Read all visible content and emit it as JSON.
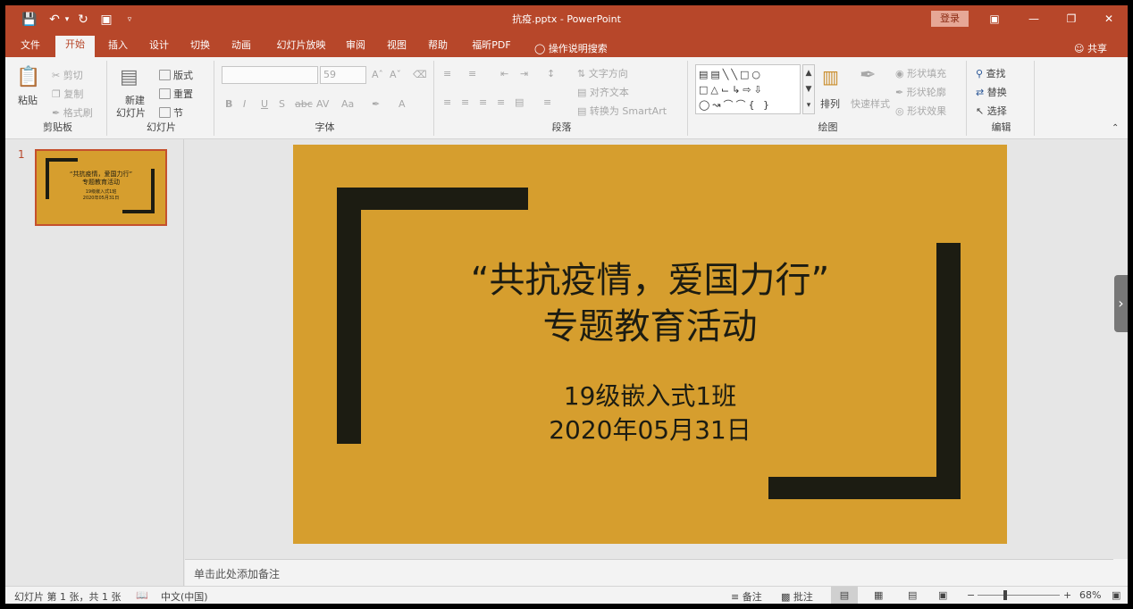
{
  "window": {
    "title": "抗疫.pptx  -  PowerPoint",
    "login": "登录"
  },
  "qat": {
    "save": "save-icon",
    "undo": "undo-icon",
    "redo": "redo-icon"
  },
  "tabs": [
    "文件",
    "开始",
    "插入",
    "设计",
    "切换",
    "动画",
    "幻灯片放映",
    "审阅",
    "视图",
    "帮助",
    "福昕PDF"
  ],
  "active_tab": "开始",
  "tellme": "操作说明搜索",
  "share": "共享",
  "ribbon": {
    "clipboard": {
      "label": "剪贴板",
      "paste": "粘贴",
      "cut": "剪切",
      "copy": "复制",
      "format_painter": "格式刷"
    },
    "slides": {
      "label": "幻灯片",
      "new_slide_1": "新建",
      "new_slide_2": "幻灯片",
      "layout": "版式",
      "reset": "重置",
      "section": "节"
    },
    "font": {
      "label": "字体",
      "font_name": "",
      "font_size": "59"
    },
    "paragraph": {
      "label": "段落",
      "text_direction": "文字方向",
      "align_text": "对齐文本",
      "smartart": "转换为 SmartArt"
    },
    "drawing": {
      "label": "绘图",
      "arrange": "排列",
      "quick_styles": "快速样式",
      "shape_fill": "形状填充",
      "shape_outline": "形状轮廓",
      "shape_effects": "形状效果"
    },
    "editing": {
      "label": "编辑",
      "find": "查找",
      "replace": "替换",
      "select": "选择"
    }
  },
  "thumbnail": {
    "number": "1",
    "title_1": "“共抗疫情，爱国力行”",
    "title_2": "专题教育活动",
    "sub_1": "19级嵌入式1班",
    "sub_2": "2020年05月31日"
  },
  "slide": {
    "title_line1": "“共抗疫情，爱国力行”",
    "title_line2": "专题教育活动",
    "subtitle_line1": "19级嵌入式1班",
    "subtitle_line2": "2020年05月31日",
    "background": "#d69e2e",
    "bracket_color": "#1c1c12"
  },
  "notes_placeholder": "单击此处添加备注",
  "status": {
    "slide_info": "幻灯片 第 1 张，共 1 张",
    "language": "中文(中国)",
    "notes": "备注",
    "comments": "批注",
    "zoom": "68%"
  }
}
